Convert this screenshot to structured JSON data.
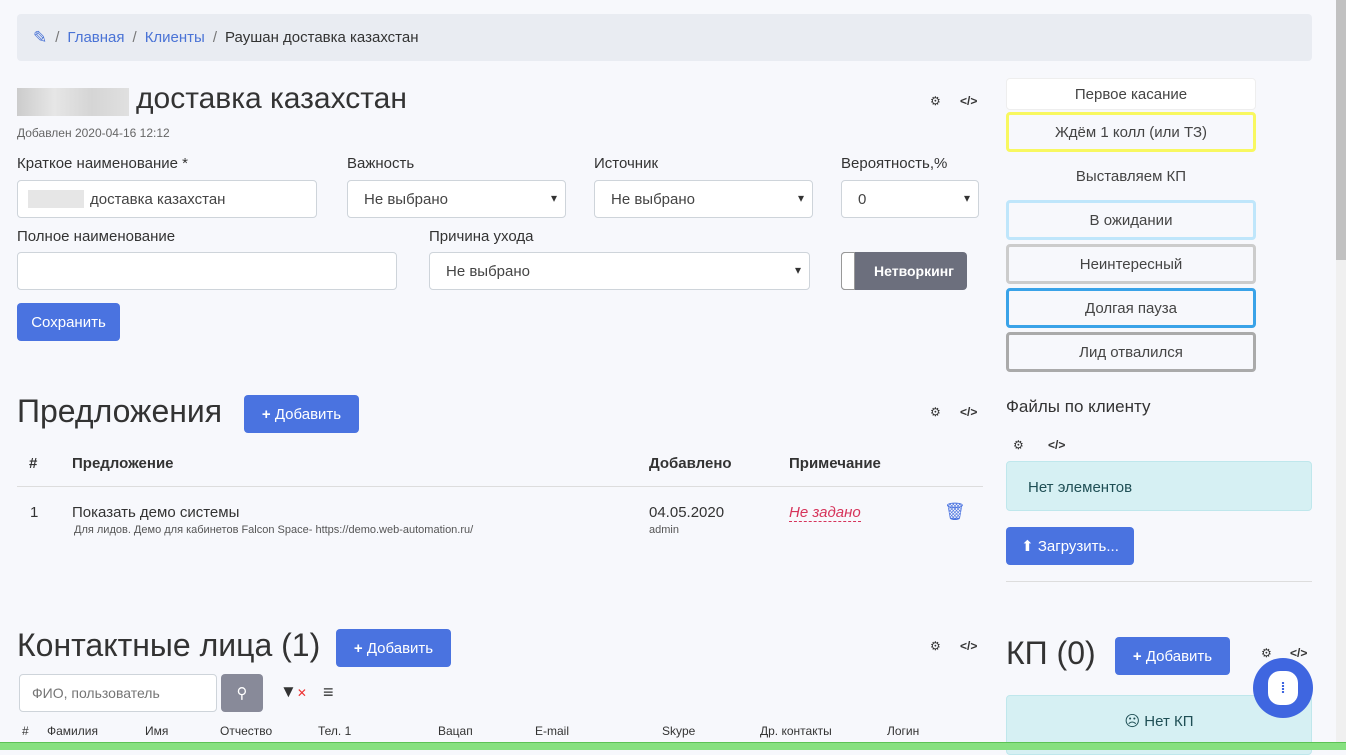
{
  "breadcrumb": {
    "home": "Главная",
    "clients": "Клиенты",
    "current": "Раушан доставка казахстан"
  },
  "header": {
    "title": "доставка казахстан",
    "added": "Добавлен 2020-04-16 12:12"
  },
  "form": {
    "short_name_label": "Краткое наименование *",
    "short_name_value": "доставка казахстан",
    "importance_label": "Важность",
    "importance_value": "Не выбрано",
    "source_label": "Источник",
    "source_value": "Не выбрано",
    "probability_label": "Вероятность,%",
    "probability_value": "0",
    "full_name_label": "Полное наименование",
    "full_name_value": "",
    "reason_label": "Причина ухода",
    "reason_value": "Не выбрано",
    "networking_label": "Нетворкинг",
    "save_label": "Сохранить"
  },
  "stages": [
    {
      "label": "Первое касание",
      "border": "#eeeeee"
    },
    {
      "label": "Ждём 1 колл (или ТЗ)",
      "border": "#f8f860"
    },
    {
      "label": "Выставляем КП",
      "border": "transparent"
    },
    {
      "label": "В ожидании",
      "border": "#bfe6fb"
    },
    {
      "label": "Неинтересный",
      "border": "#cccccc"
    },
    {
      "label": "Долгая пауза",
      "border": "#3aa3e8"
    },
    {
      "label": "Лид отвалился",
      "border": "#aaaaaa"
    }
  ],
  "files": {
    "title": "Файлы по клиенту",
    "empty": "Нет элементов",
    "upload": "Загрузить..."
  },
  "offers": {
    "title": "Предложения",
    "add": "Добавить",
    "columns": [
      "#",
      "Предложение",
      "Добавлено",
      "Примечание"
    ],
    "rows": [
      {
        "num": "1",
        "name": "Показать демо системы",
        "desc": "Для лидов. Демо для кабинетов Falcon Space- https://demo.web-automation.ru/",
        "date": "04.05.2020",
        "author": "admin",
        "note": "Не задано"
      }
    ]
  },
  "contacts": {
    "title": "Контактные лица (1)",
    "add": "Добавить",
    "search_placeholder": "ФИО, пользователь",
    "columns": [
      "#",
      "Фамилия",
      "Имя",
      "Отчество",
      "Тел. 1",
      "Вацап",
      "E-mail",
      "Skype",
      "Др. контакты",
      "Логин"
    ]
  },
  "kp": {
    "title": "КП (0)",
    "add": "Добавить",
    "empty": "Нет КП"
  },
  "colors": {
    "accent": "#4a73e0",
    "bottom_bar": "#86e07f"
  }
}
